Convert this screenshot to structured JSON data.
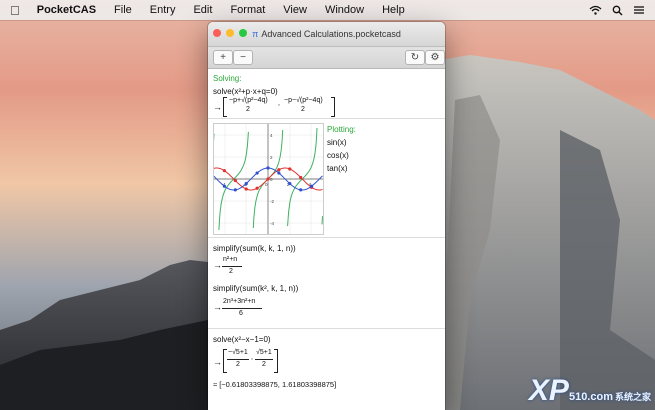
{
  "menubar": {
    "app_name": "PocketCAS",
    "items": [
      "File",
      "Entry",
      "Edit",
      "Format",
      "View",
      "Window",
      "Help"
    ]
  },
  "window": {
    "title": "Advanced Calculations.pocketcasd",
    "toolbar": {
      "add": "+",
      "remove": "−",
      "refresh": "↻",
      "settings": "⚙"
    }
  },
  "cells": {
    "solving": {
      "label": "Solving:",
      "input": "solve(x²+p·x+q=0)",
      "result_1": "−p+√(p²−4q)",
      "result_2": "−p−√(p²−4q)",
      "denom": "2"
    },
    "plotting": {
      "label": "Plotting:",
      "functions": [
        "sin(x)",
        "cos(x)",
        "tan(x)"
      ],
      "x_ticks": [
        "-4",
        "-2",
        "0",
        "2",
        "4"
      ],
      "y_ticks": [
        "4",
        "2",
        "0",
        "-2",
        "-4"
      ]
    },
    "simplify": {
      "input_1": "simplify(sum(k, k, 1, n))",
      "result_1_num": "n²+n",
      "result_1_den": "2",
      "input_2": "simplify(sum(k², k, 1, n))",
      "result_2_num": "2n³+3n²+n",
      "result_2_den": "6"
    },
    "golden": {
      "input": "solve(x²−x−1=0)",
      "result_1_num": "−√5+1",
      "result_2_num": "√5+1",
      "denom": "2",
      "approx": "≈ [−0.61803398875, 1.61803398875]"
    }
  },
  "watermark": {
    "main": "XP",
    "sub": "510.com",
    "cn": "系统之家"
  },
  "colors": {
    "accent_green": "#2aa83a",
    "sin": "#e03030",
    "cos": "#3050d0",
    "tan": "#40b060"
  }
}
